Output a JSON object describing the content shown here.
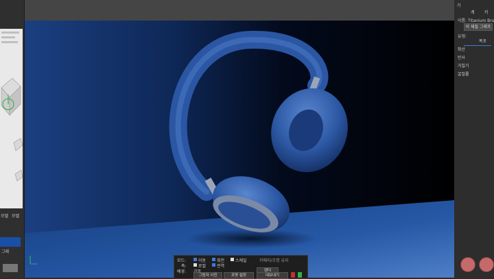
{
  "left_panel": {
    "tabs": [
      "모델",
      "모델"
    ],
    "label": "그래"
  },
  "right_panel": {
    "top_labels": [
      "가",
      "계",
      "키"
    ],
    "rows": [
      "이름: Titanium Brushed",
      "유형:",
      "확산",
      "반사",
      "거칠기",
      "굴절률"
    ],
    "button_label": "이 재질 그래프",
    "field_label": "폭포"
  },
  "toolbar": {
    "row1_labels": [
      "모드:",
      "이동",
      "회전",
      "스케일"
    ],
    "row2_labels": [
      "축:",
      "로컬",
      "전역"
    ],
    "row3_label": "배경:",
    "row3_value": "기본",
    "note": "카메라/조명 유지",
    "buttons": [
      "그림자 사진",
      "조명 설정",
      "렌더",
      "내보내기"
    ]
  },
  "colors": {
    "accent": "#3b7bd8",
    "headphone_blue": "#2d5aa8",
    "floor_blue": "#1a4f96",
    "record": "#c03030",
    "ok": "#2fb04a"
  }
}
